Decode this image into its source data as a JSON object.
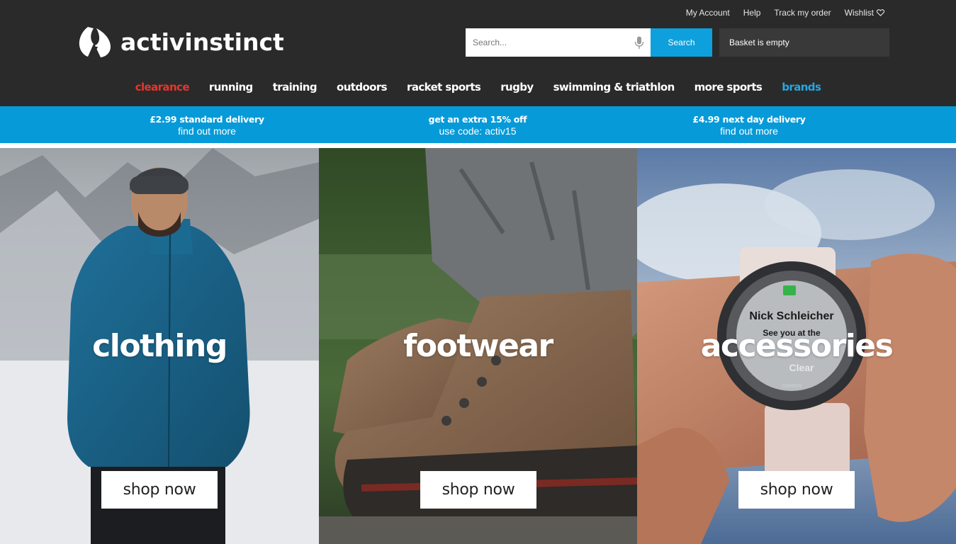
{
  "header": {
    "logo_text": "activinstinct",
    "util_links": [
      "My Account",
      "Help",
      "Track my order",
      "Wishlist"
    ],
    "search": {
      "placeholder": "Search...",
      "button_label": "Search"
    },
    "basket_label": "Basket is empty"
  },
  "nav": {
    "items": [
      "clearance",
      "running",
      "training",
      "outdoors",
      "racket sports",
      "rugby",
      "swimming & triathlon",
      "more sports",
      "brands"
    ]
  },
  "promo": [
    {
      "line1": "£2.99 standard delivery",
      "line2": "find out more"
    },
    {
      "line1": "get an extra 15% off",
      "line2": "use code: activ15"
    },
    {
      "line1": "£4.99 next day delivery",
      "line2": "find out more"
    }
  ],
  "tiles": [
    {
      "title": "clothing",
      "button": "shop now"
    },
    {
      "title": "footwear",
      "button": "shop now"
    },
    {
      "title": "accessories",
      "button": "shop now"
    }
  ],
  "watch_screen": {
    "name": "Nick Schleicher",
    "message": "See you at the",
    "action": "Clear",
    "brand": "GARMIN"
  },
  "colors": {
    "header_bg": "#2a2a2a",
    "promo_bg": "#079ad8",
    "search_button": "#0ea0dc",
    "clearance": "#e8352e",
    "brands": "#26a8e0"
  },
  "icons": [
    "logo-mark-icon",
    "mic-icon",
    "heart-icon"
  ]
}
